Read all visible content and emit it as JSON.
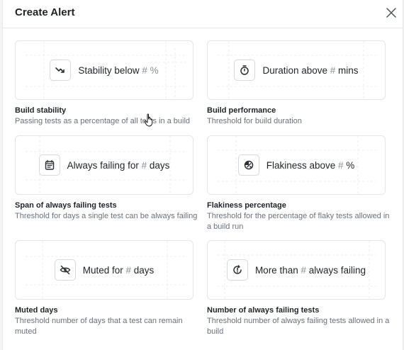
{
  "dialog": {
    "title": "Create Alert",
    "close_icon": "close-icon"
  },
  "cards": [
    {
      "icon": "trend-down-icon",
      "label_pre": "Stability below ",
      "label_hl": "# %",
      "label_post": "",
      "title": "Build stability",
      "description": "Passing tests as a percentage of all tests in a build"
    },
    {
      "icon": "stopwatch-icon",
      "label_pre": "Duration above ",
      "label_hl": "#",
      "label_post": " mins",
      "title": "Build performance",
      "description": "Threshold for build duration"
    },
    {
      "icon": "calendar-list-icon",
      "label_pre": "Always failing for ",
      "label_hl": "#",
      "label_post": " days",
      "title": "Span of always failing tests",
      "description": "Threshold for days a single test can be always failing"
    },
    {
      "icon": "flaky-icon",
      "label_pre": "Flakiness above ",
      "label_hl": "#",
      "label_post": " %",
      "title": "Flakiness percentage",
      "description": "Threshold for the percentage of flaky tests allowed in a build run"
    },
    {
      "icon": "muted-eye-icon",
      "label_pre": "Muted for ",
      "label_hl": "#",
      "label_post": " days",
      "title": "Muted days",
      "description": "Threshold number of days that a test can remain muted"
    },
    {
      "icon": "refresh-alert-icon",
      "label_pre": "More than ",
      "label_hl": "#",
      "label_post": " always failing",
      "title": "Number of always failing tests",
      "description": "Threshold number of always failing tests allowed in a build"
    }
  ]
}
